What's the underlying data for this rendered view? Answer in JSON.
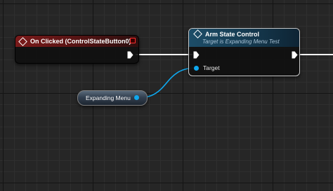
{
  "graph": {
    "event_node": {
      "title": "On Clicked (ControlStateButton0)",
      "header_color": "#7a1a1a",
      "icon": "function-diamond-icon",
      "delegate_icon": "delegate-square-icon"
    },
    "function_node": {
      "title": "Arm State Control",
      "subtitle": "Target is Expanding Menu Test",
      "header_color": "#1d4d68",
      "icon": "function-diamond-icon",
      "target_pin_label": "Target"
    },
    "variable_node": {
      "name": "Expanding Menu",
      "pin_color": "#0fa8ee"
    },
    "colors": {
      "exec_wire": "#ffffff",
      "object_wire": "#0fa8ee",
      "grid_background": "#262626"
    }
  }
}
